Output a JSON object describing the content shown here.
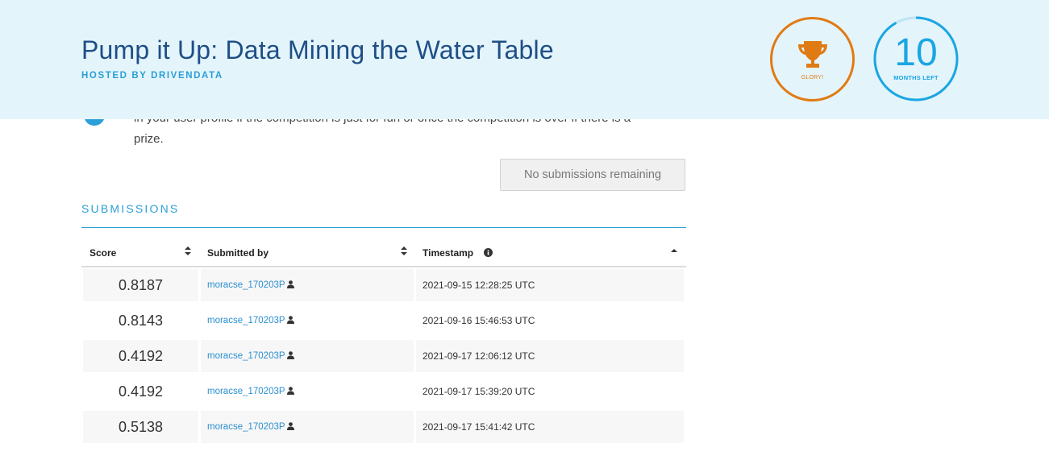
{
  "header": {
    "title": "Pump it Up: Data Mining the Water Table",
    "subtitle": "HOSTED BY DRIVENDATA",
    "prize_badge": {
      "label": "GLORY!",
      "icon": "trophy-icon",
      "color": "#e07b14"
    },
    "time_badge": {
      "number": "10",
      "label": "MONTHS LEFT",
      "color": "#1aa6e2",
      "progress_fraction": 0.92
    }
  },
  "info_notice": {
    "icon": "info-icon",
    "line1": "in your user profile if the competition is just for fun or once the competition is over if there is a",
    "line2": "prize."
  },
  "no_submissions_button": "No submissions remaining",
  "submissions": {
    "section_title": "SUBMISSIONS",
    "columns": {
      "score": "Score",
      "submitted_by": "Submitted by",
      "timestamp": "Timestamp"
    },
    "rows": [
      {
        "score": "0.8187",
        "user": "moracse_170203P",
        "timestamp": "2021-09-15 12:28:25 UTC"
      },
      {
        "score": "0.8143",
        "user": "moracse_170203P",
        "timestamp": "2021-09-16 15:46:53 UTC"
      },
      {
        "score": "0.4192",
        "user": "moracse_170203P",
        "timestamp": "2021-09-17 12:06:12 UTC"
      },
      {
        "score": "0.4192",
        "user": "moracse_170203P",
        "timestamp": "2021-09-17 15:39:20 UTC"
      },
      {
        "score": "0.5138",
        "user": "moracse_170203P",
        "timestamp": "2021-09-17 15:41:42 UTC"
      }
    ]
  },
  "colors": {
    "accent": "#2a9fd8",
    "header_bg": "#e4f4fb",
    "title": "#1e4f86",
    "link": "#2a8fd0"
  }
}
